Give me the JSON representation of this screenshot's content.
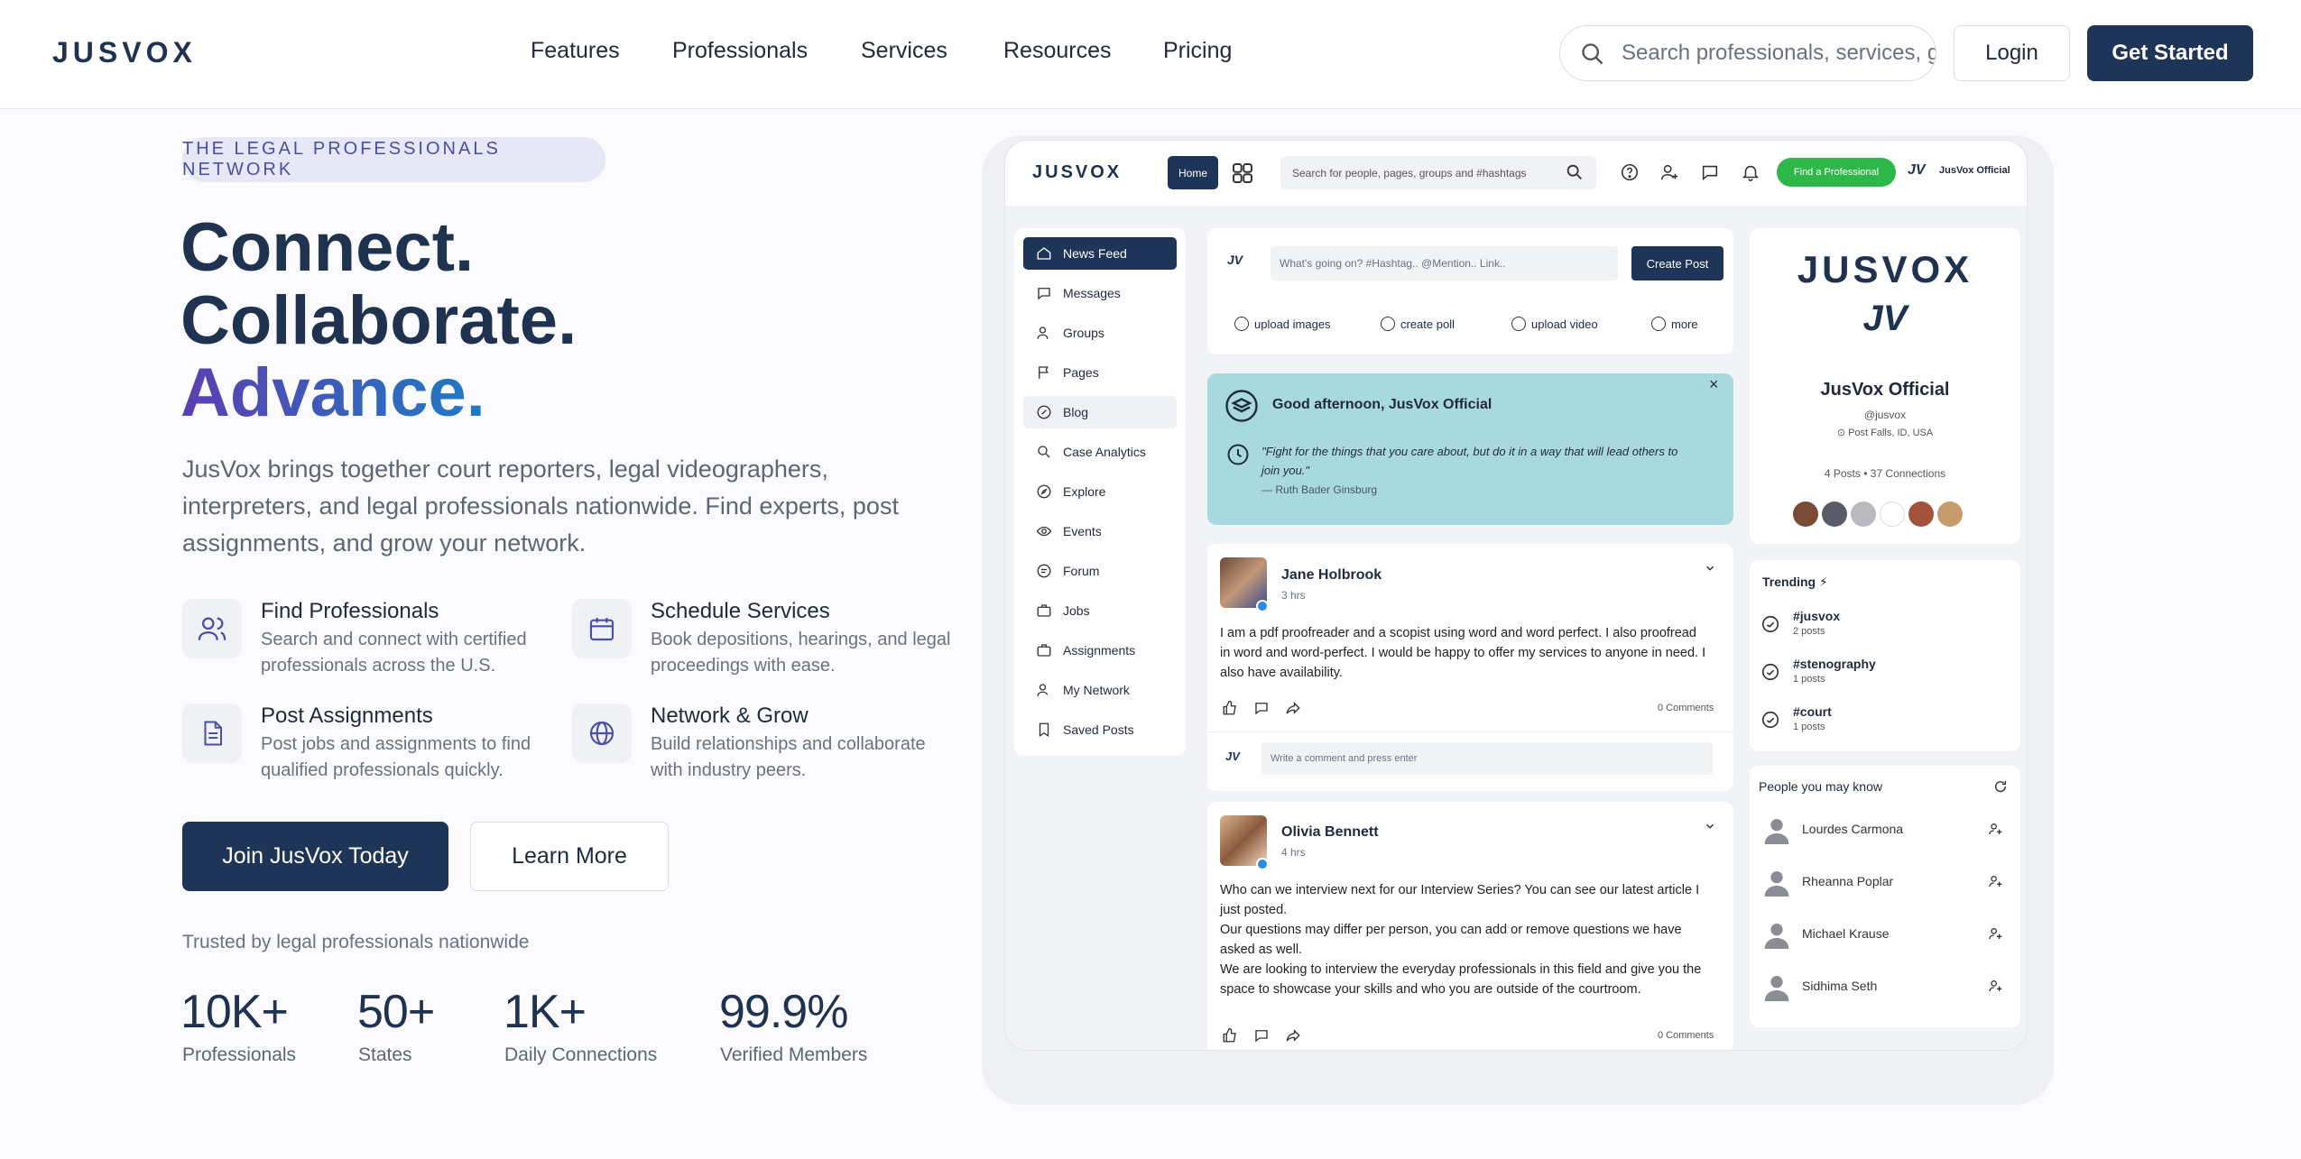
{
  "header": {
    "logo": "JUSVOX",
    "nav": [
      "Features",
      "Professionals",
      "Services",
      "Resources",
      "Pricing"
    ],
    "search_placeholder": "Search professionals, services, g",
    "login": "Login",
    "get_started": "Get Started"
  },
  "hero": {
    "badge": "THE LEGAL PROFESSIONALS NETWORK",
    "line1": "Connect.",
    "line2": "Collaborate.",
    "line3": "Advance.",
    "lead": "JusVox brings together court reporters, legal videographers, interpreters, and legal professionals nationwide. Find experts, post assignments, and grow your network.",
    "features": [
      {
        "title": "Find Professionals",
        "desc": "Search and connect with certified professionals across the U.S.",
        "icon": "users-icon"
      },
      {
        "title": "Schedule Services",
        "desc": "Book depositions, hearings, and legal proceedings with ease.",
        "icon": "calendar-icon"
      },
      {
        "title": "Post Assignments",
        "desc": "Post jobs and assignments to find qualified professionals quickly.",
        "icon": "document-icon"
      },
      {
        "title": "Network & Grow",
        "desc": "Build relationships and collaborate with industry peers.",
        "icon": "globe-icon"
      }
    ],
    "join": "Join JusVox Today",
    "learn": "Learn More",
    "trusted": "Trusted by legal professionals nationwide",
    "stats": [
      {
        "value": "10K+",
        "label": "Professionals"
      },
      {
        "value": "50+",
        "label": "States"
      },
      {
        "value": "1K+",
        "label": "Daily Connections"
      },
      {
        "value": "99.9%",
        "label": "Verified Members"
      }
    ]
  },
  "mock": {
    "logo": "JUSVOX",
    "home": "Home",
    "search_placeholder": "Search for people, pages, groups and #hashtags",
    "find_pro": "Find a Professional",
    "jv": "JV",
    "user": "JusVox Official",
    "sidebar": [
      "News Feed",
      "Messages",
      "Groups",
      "Pages",
      "Blog",
      "Case Analytics",
      "Explore",
      "Events",
      "Forum",
      "Jobs",
      "Assignments",
      "My Network",
      "Saved Posts"
    ],
    "composer": {
      "placeholder": "What's going on? #Hashtag.. @Mention.. Link..",
      "create_post": "Create Post",
      "actions": [
        "upload images",
        "create poll",
        "upload video",
        "more"
      ]
    },
    "greeting": {
      "title": "Good afternoon, JusVox Official",
      "quote": "\"Fight for the things that you care about, but do it in a way that will lead others to join you.\"",
      "author": "— Ruth Bader Ginsburg",
      "close": "×"
    },
    "posts": [
      {
        "name": "Jane Holbrook",
        "time": "3 hrs",
        "body": "I am a pdf proofreader and a scopist using word and word perfect. I also proofread in word and word-perfect. I would be happy to offer my services to anyone in need. I also have availability.",
        "comments": "0 Comments",
        "comment_placeholder": "Write a comment and press enter"
      },
      {
        "name": "Olivia Bennett",
        "time": "4 hrs",
        "body1": "Who can we interview next for our Interview Series? You can see our latest article I just posted.",
        "body2": "Our questions may differ per person, you can add or remove questions we have asked as well.",
        "body3": "We are looking to interview the everyday professionals in this field and give you the space to showcase your skills and who you are outside of the courtroom.",
        "comments": "0 Comments"
      }
    ],
    "profile": {
      "logo": "JUSVOX",
      "mark": "JV",
      "name": "JusVox Official",
      "handle": "@jusvox",
      "location": "Post Falls, ID, USA",
      "meta": "4 Posts • 37 Connections"
    },
    "trending": {
      "title": "Trending ⚡",
      "items": [
        {
          "tag": "#jusvox",
          "count": "2 posts"
        },
        {
          "tag": "#stenography",
          "count": "1 posts"
        },
        {
          "tag": "#court",
          "count": "1 posts"
        }
      ]
    },
    "people": {
      "title": "People you may know",
      "items": [
        "Lourdes Carmona",
        "Rheanna Poplar",
        "Michael Krause",
        "Sidhima Seth"
      ]
    }
  },
  "colors": {
    "brand": "#1e3558",
    "green": "#2fb84a",
    "greeting_bg": "#a8d9e0"
  }
}
